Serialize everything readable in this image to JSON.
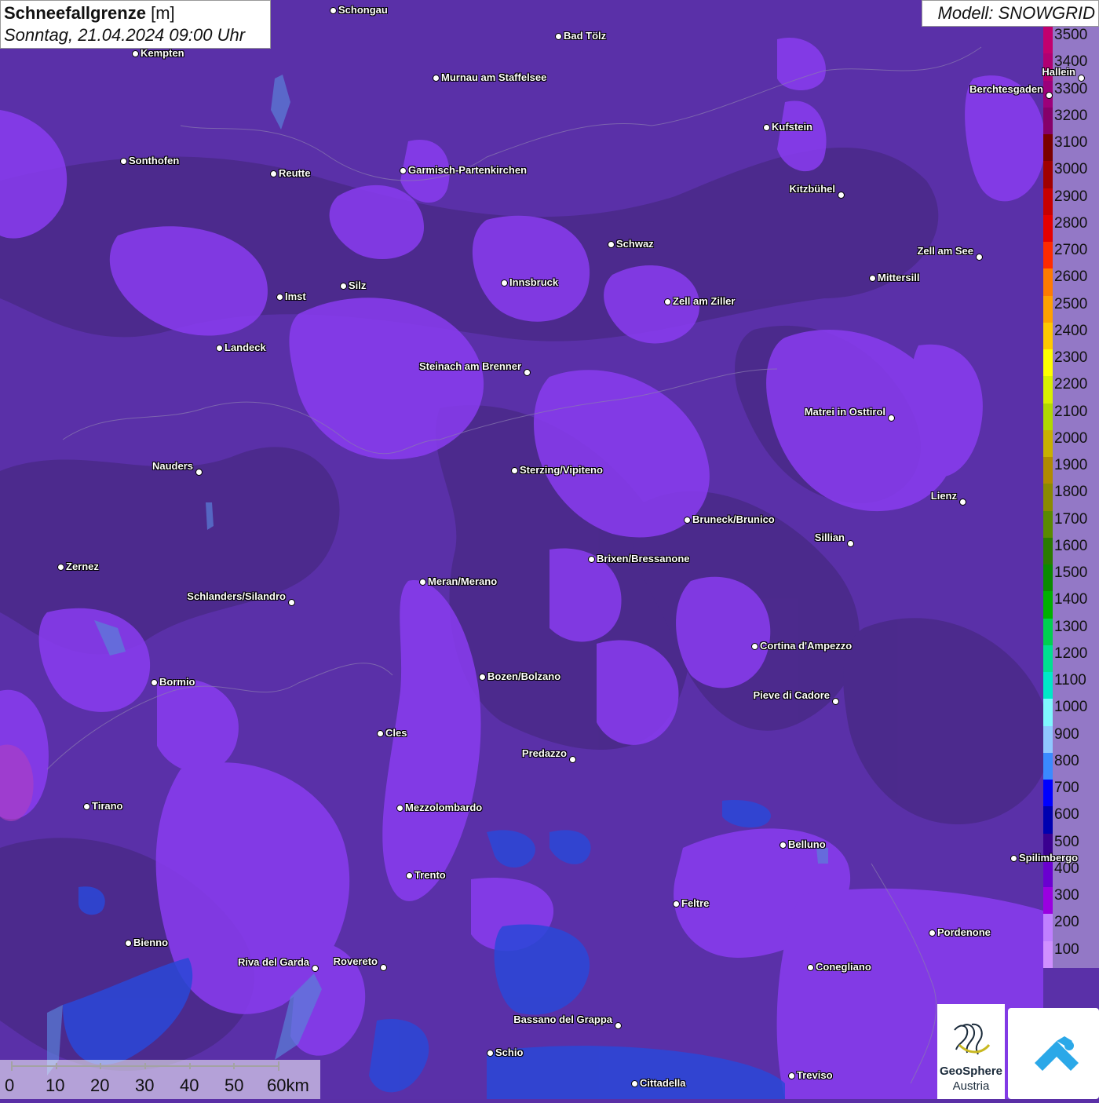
{
  "title": {
    "parameter": "Schneefallgrenze",
    "unit": "[m]",
    "datetime": "Sonntag, 21.04.2024 09:00 Uhr"
  },
  "model": "Modell: SNOWGRID",
  "legend": {
    "labels": [
      "3500",
      "3400",
      "3300",
      "3200",
      "3100",
      "3000",
      "2900",
      "2800",
      "2700",
      "2600",
      "2500",
      "2400",
      "2300",
      "2200",
      "2100",
      "2000",
      "1900",
      "1800",
      "1700",
      "1600",
      "1500",
      "1400",
      "1300",
      "1200",
      "1100",
      "1000",
      "900",
      "800",
      "700",
      "600",
      "500",
      "400",
      "300",
      "200",
      "100"
    ],
    "colors": [
      "#c2006e",
      "#b00072",
      "#9c007a",
      "#86006a",
      "#7a0000",
      "#a00000",
      "#c80000",
      "#e60000",
      "#ff2a00",
      "#ff7a00",
      "#ffa000",
      "#ffc800",
      "#ffff00",
      "#d8f000",
      "#b0d800",
      "#c8b000",
      "#b08a00",
      "#8a8a00",
      "#5a8a00",
      "#2a7a00",
      "#0a8a00",
      "#00b000",
      "#00d050",
      "#00e090",
      "#00e8c8",
      "#80f8ff",
      "#90c8ff",
      "#3a8aff",
      "#0000ff",
      "#0000b0",
      "#3a0090",
      "#6a00d0",
      "#9a00e0",
      "#c080ff",
      "#d090ff"
    ]
  },
  "cities": [
    {
      "name": "Schongau",
      "label_side": "right"
    },
    {
      "name": "Bad Tölz",
      "label_side": "right"
    },
    {
      "name": "Kempten",
      "label_side": "right"
    },
    {
      "name": "Murnau am Staffelsee",
      "label_side": "right"
    },
    {
      "name": "Hallein",
      "label_side": "left"
    },
    {
      "name": "Berchtesgaden",
      "label_side": "left"
    },
    {
      "name": "Kufstein",
      "label_side": "right"
    },
    {
      "name": "Sonthofen",
      "label_side": "right"
    },
    {
      "name": "Reutte",
      "label_side": "right"
    },
    {
      "name": "Garmisch-Partenkirchen",
      "label_side": "right"
    },
    {
      "name": "Kitzbühel",
      "label_side": "left"
    },
    {
      "name": "Schwaz",
      "label_side": "right"
    },
    {
      "name": "Zell am See",
      "label_side": "left"
    },
    {
      "name": "Mittersill",
      "label_side": "right"
    },
    {
      "name": "Innsbruck",
      "label_side": "right"
    },
    {
      "name": "Imst",
      "label_side": "right"
    },
    {
      "name": "Silz",
      "label_side": "right"
    },
    {
      "name": "Zell am Ziller",
      "label_side": "right"
    },
    {
      "name": "Landeck",
      "label_side": "right"
    },
    {
      "name": "Steinach am Brenner",
      "label_side": "left"
    },
    {
      "name": "Matrei in Osttirol",
      "label_side": "left"
    },
    {
      "name": "Nauders",
      "label_side": "left"
    },
    {
      "name": "Sterzing/Vipiteno",
      "label_side": "right"
    },
    {
      "name": "Lienz",
      "label_side": "left"
    },
    {
      "name": "Bruneck/Brunico",
      "label_side": "right"
    },
    {
      "name": "Sillian",
      "label_side": "left"
    },
    {
      "name": "Zernez",
      "label_side": "right"
    },
    {
      "name": "Brixen/Bressanone",
      "label_side": "right"
    },
    {
      "name": "Meran/Merano",
      "label_side": "right"
    },
    {
      "name": "Schlanders/Silandro",
      "label_side": "left"
    },
    {
      "name": "Cortina d'Ampezzo",
      "label_side": "right"
    },
    {
      "name": "Bozen/Bolzano",
      "label_side": "right"
    },
    {
      "name": "Bormio",
      "label_side": "right"
    },
    {
      "name": "Pieve di Cadore",
      "label_side": "left"
    },
    {
      "name": "Cles",
      "label_side": "right"
    },
    {
      "name": "Predazzo",
      "label_side": "left"
    },
    {
      "name": "Tirano",
      "label_side": "right"
    },
    {
      "name": "Mezzolombardo",
      "label_side": "right"
    },
    {
      "name": "Belluno",
      "label_side": "right"
    },
    {
      "name": "Spilimbergo",
      "label_side": "right"
    },
    {
      "name": "Trento",
      "label_side": "right"
    },
    {
      "name": "Feltre",
      "label_side": "right"
    },
    {
      "name": "Pordenone",
      "label_side": "right"
    },
    {
      "name": "Bienno",
      "label_side": "right"
    },
    {
      "name": "Riva del Garda",
      "label_side": "left"
    },
    {
      "name": "Rovereto",
      "label_side": "left"
    },
    {
      "name": "Conegliano",
      "label_side": "right"
    },
    {
      "name": "Bassano del Grappa",
      "label_side": "left"
    },
    {
      "name": "Schio",
      "label_side": "right"
    },
    {
      "name": "Treviso",
      "label_side": "right"
    },
    {
      "name": "Cittadella",
      "label_side": "right"
    }
  ],
  "scale_bar": {
    "labels": [
      "0",
      "10",
      "20",
      "30",
      "40",
      "50",
      "60km"
    ]
  },
  "logos": {
    "geosphere_line1": "GeoSphere",
    "geosphere_line2": "Austria"
  },
  "colors": {
    "background": "#5a2fa6",
    "dark_region": "#4a2a8c",
    "light_region": "#8a3cf0",
    "blue_region": "#2a4adc",
    "magenta_region": "#c040c8"
  }
}
